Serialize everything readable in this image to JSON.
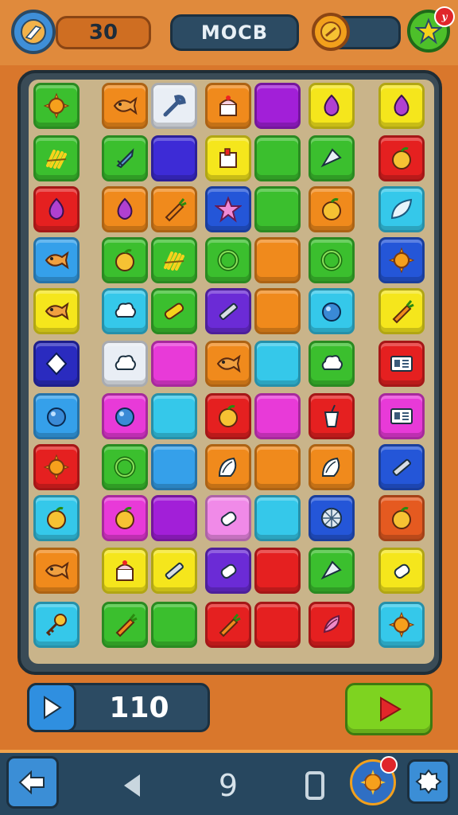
{
  "hud": {
    "score": "30",
    "level_name": "MOCB",
    "moves": "110",
    "nav_page": "9",
    "star_badge": "y"
  },
  "board": {
    "rows": [
      [
        {
          "c": "#3bbf2e",
          "i": "sun"
        },
        {
          "c": "#f08a1c",
          "i": "fish"
        },
        {
          "c": "#e9eef5",
          "i": "wrench"
        },
        {
          "c": "#f08a1c",
          "i": "cake"
        },
        {
          "c": "#a21fd8",
          "i": ""
        },
        {
          "c": "#f5e61c",
          "i": "drop"
        },
        {
          "c": "#f5e61c",
          "i": "drop"
        }
      ],
      [
        {
          "c": "#3bbf2e",
          "i": "hay"
        },
        {
          "c": "#3bbf2e",
          "i": "rocket"
        },
        {
          "c": "#3d2bd6",
          "i": ""
        },
        {
          "c": "#f5e61c",
          "i": "box"
        },
        {
          "c": "#3bbf2e",
          "i": ""
        },
        {
          "c": "#3bbf2e",
          "i": "kite"
        },
        {
          "c": "#e52020",
          "i": "fruit"
        }
      ],
      [
        {
          "c": "#e52020",
          "i": "drop"
        },
        {
          "c": "#f08a1c",
          "i": "drop"
        },
        {
          "c": "#f08a1c",
          "i": "carrot"
        },
        {
          "c": "#2456d8",
          "i": "star"
        },
        {
          "c": "#3bbf2e",
          "i": ""
        },
        {
          "c": "#f08a1c",
          "i": "fruit"
        },
        {
          "c": "#35c8ea",
          "i": "leaf"
        }
      ],
      [
        {
          "c": "#35a0ea",
          "i": "fish"
        },
        {
          "c": "#3bbf2e",
          "i": "fruit"
        },
        {
          "c": "#3bbf2e",
          "i": "hay"
        },
        {
          "c": "#3bbf2e",
          "i": "ring"
        },
        {
          "c": "#f08a1c",
          "i": ""
        },
        {
          "c": "#3bbf2e",
          "i": "ring"
        },
        {
          "c": "#2456d8",
          "i": "sun"
        }
      ],
      [
        {
          "c": "#f5e61c",
          "i": "fish"
        },
        {
          "c": "#35c8ea",
          "i": "cloud"
        },
        {
          "c": "#3bbf2e",
          "i": "bar"
        },
        {
          "c": "#6b2bd6",
          "i": "pencil"
        },
        {
          "c": "#f08a1c",
          "i": ""
        },
        {
          "c": "#35c8ea",
          "i": "ball"
        },
        {
          "c": "#f5e61c",
          "i": "carrot"
        }
      ],
      [
        {
          "c": "#2a2bbf",
          "i": "diamond"
        },
        {
          "c": "#e9eef5",
          "i": "cloud"
        },
        {
          "c": "#e83ad8",
          "i": ""
        },
        {
          "c": "#f08a1c",
          "i": "fish"
        },
        {
          "c": "#35c8ea",
          "i": ""
        },
        {
          "c": "#3bbf2e",
          "i": "cloud"
        },
        {
          "c": "#e52020",
          "i": "screen"
        }
      ],
      [
        {
          "c": "#35a0ea",
          "i": "ball"
        },
        {
          "c": "#e83ad8",
          "i": "ball"
        },
        {
          "c": "#35c8ea",
          "i": ""
        },
        {
          "c": "#e52020",
          "i": "fruit"
        },
        {
          "c": "#e83ad8",
          "i": ""
        },
        {
          "c": "#e52020",
          "i": "cup"
        },
        {
          "c": "#e83ad8",
          "i": "screen"
        }
      ],
      [
        {
          "c": "#e52020",
          "i": "sun"
        },
        {
          "c": "#3bbf2e",
          "i": "ring"
        },
        {
          "c": "#35a0ea",
          "i": ""
        },
        {
          "c": "#f08a1c",
          "i": "shell"
        },
        {
          "c": "#f08a1c",
          "i": ""
        },
        {
          "c": "#f08a1c",
          "i": "shell"
        },
        {
          "c": "#2456d8",
          "i": "pencil"
        }
      ],
      [
        {
          "c": "#35c8ea",
          "i": "fruit"
        },
        {
          "c": "#e83ad8",
          "i": "fruit"
        },
        {
          "c": "#a21fd8",
          "i": ""
        },
        {
          "c": "#f08ae8",
          "i": "bottle"
        },
        {
          "c": "#35c8ea",
          "i": ""
        },
        {
          "c": "#2456d8",
          "i": "net"
        },
        {
          "c": "#e55a20",
          "i": "fruit"
        }
      ],
      [
        {
          "c": "#f08a1c",
          "i": "fish"
        },
        {
          "c": "#f5e61c",
          "i": "cake"
        },
        {
          "c": "#f5e61c",
          "i": "pencil"
        },
        {
          "c": "#6b2bd6",
          "i": "bottle"
        },
        {
          "c": "#e52020",
          "i": ""
        },
        {
          "c": "#3bbf2e",
          "i": "kite"
        },
        {
          "c": "#f5e61c",
          "i": "bottle"
        }
      ],
      [
        {
          "c": "#35c8ea",
          "i": "key"
        },
        {
          "c": "#3bbf2e",
          "i": "carrot"
        },
        {
          "c": "#3bbf2e",
          "i": ""
        },
        {
          "c": "#e52020",
          "i": "carrot"
        },
        {
          "c": "#e52020",
          "i": ""
        },
        {
          "c": "#e52020",
          "i": "grape"
        },
        {
          "c": "#35c8ea",
          "i": "sun"
        }
      ]
    ]
  },
  "colors": {
    "frame": "#3a4b56",
    "accent": "#e08a3c",
    "nav": "#27475f"
  }
}
